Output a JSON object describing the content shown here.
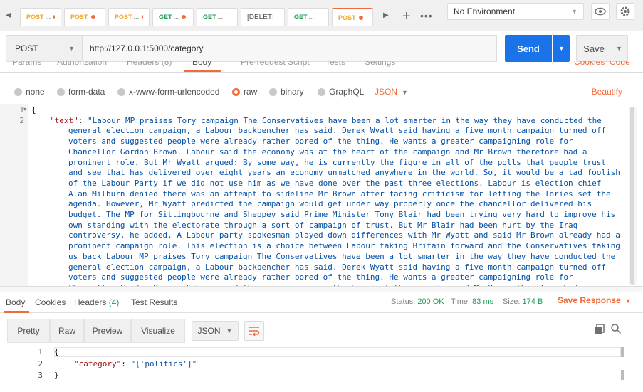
{
  "tabs": [
    {
      "method": "POST",
      "label": "POST",
      "dots": "...",
      "unsaved": true
    },
    {
      "method": "POST",
      "label": "POST",
      "dots": "",
      "unsaved": true
    },
    {
      "method": "POST",
      "label": "POST",
      "dots": "...",
      "unsaved": true
    },
    {
      "method": "GET",
      "label": "GET",
      "dots": "...",
      "unsaved": true
    },
    {
      "method": "GET",
      "label": "GET",
      "dots": "...",
      "unsaved": false
    },
    {
      "method": "DELETE",
      "label": "[DELETI",
      "dots": "",
      "unsaved": false
    },
    {
      "method": "GET",
      "label": "GET",
      "dots": "...",
      "unsaved": false
    },
    {
      "method": "POST",
      "label": "POST",
      "dots": "",
      "unsaved": true
    }
  ],
  "environment": {
    "selected": "No Environment"
  },
  "request": {
    "method": "POST",
    "url": "http://127.0.0.1:5000/category",
    "send_label": "Send",
    "save_label": "Save"
  },
  "request_tabs": {
    "params": "Params",
    "authorization": "Authorization",
    "headers": "Headers (8)",
    "body": "Body",
    "prerequest": "Pre-request Script",
    "tests": "Tests",
    "settings": "Settings",
    "cookies": "Cookies",
    "code": "Code"
  },
  "body_types": {
    "none": "none",
    "form_data": "form-data",
    "urlencoded": "x-www-form-urlencoded",
    "raw": "raw",
    "binary": "binary",
    "graphql": "GraphQL",
    "format": "JSON",
    "beautify": "Beautify"
  },
  "editor": {
    "line1": "{",
    "line_numbers": [
      "1",
      "2"
    ],
    "key": "\"text\"",
    "first_line": "\"Labour MP praises Tory campaign The Conservatives have been a lot smarter in the way they have conducted the",
    "wrapped_lines": [
      "general election campaign, a Labour backbencher has said. Derek Wyatt said having a five month campaign turned off",
      "voters and suggested people were already rather bored of the thing. He wants a greater campaigning role for",
      "Chancellor Gordon Brown. Labour said the economy was at the heart of the campaign and Mr Brown therefore had a",
      "prominent role. But Mr Wyatt argued: By some way, he is currently the figure in all of the polls that people trust",
      "and see that has delivered over eight years an economy unmatched anywhere in the world. So, it would be a tad foolish",
      "of the Labour Party if we did not use him as we have done over the past three elections. Labour is election chief",
      "Alan Milburn denied there was an attempt to sideline Mr Brown after facing criticism for letting the Tories set the",
      "agenda. However, Mr Wyatt predicted the campaign would get under way properly once the chancellor delivered his",
      "budget. The MP for Sittingbourne and Sheppey said Prime Minister Tony Blair had been trying very hard to improve his",
      "own standing with the electorate through a sort of campaign of trust. But Mr Blair had been hurt by the Iraq",
      "controversy, he added. A Labour party spokesman played down differences with Mr Wyatt and said Mr Brown already had a",
      "prominent campaign role. This election is a choice between Labour taking Britain forward and the Conservatives taking",
      "us back Labour MP praises Tory campaign The Conservatives have been a lot smarter in the way they have conducted the",
      "general election campaign, a Labour backbencher has said. Derek Wyatt said having a five month campaign turned off",
      "voters and suggested people were already rather bored of the thing. He wants a greater campaigning role for",
      "Chancellor Gordon Brown. Labour said the economy was at the heart of the campaign and Mr Brown therefore had a"
    ]
  },
  "response_tabs": {
    "body": "Body",
    "cookies": "Cookies",
    "headers_label": "Headers",
    "headers_count": "(4)",
    "test_results": "Test Results"
  },
  "response_status": {
    "status_label": "Status:",
    "status_value": "200 OK",
    "time_label": "Time:",
    "time_value": "83 ms",
    "size_label": "Size:",
    "size_value": "174 B",
    "save_response": "Save Response"
  },
  "response_toolbar": {
    "pretty": "Pretty",
    "raw": "Raw",
    "preview": "Preview",
    "visualize": "Visualize",
    "format": "JSON"
  },
  "response_body": {
    "line_numbers": [
      "1",
      "2",
      "3"
    ],
    "open_brace": "{",
    "key": "\"category\"",
    "colon": ": ",
    "value": "\"['politics']\"",
    "close_brace": "}"
  },
  "colors": {
    "accent": "#f26b3a",
    "send": "#1a73e8",
    "get_method": "#1f9d55",
    "post_method": "#f5a623",
    "status_ok": "#1f9d55"
  }
}
